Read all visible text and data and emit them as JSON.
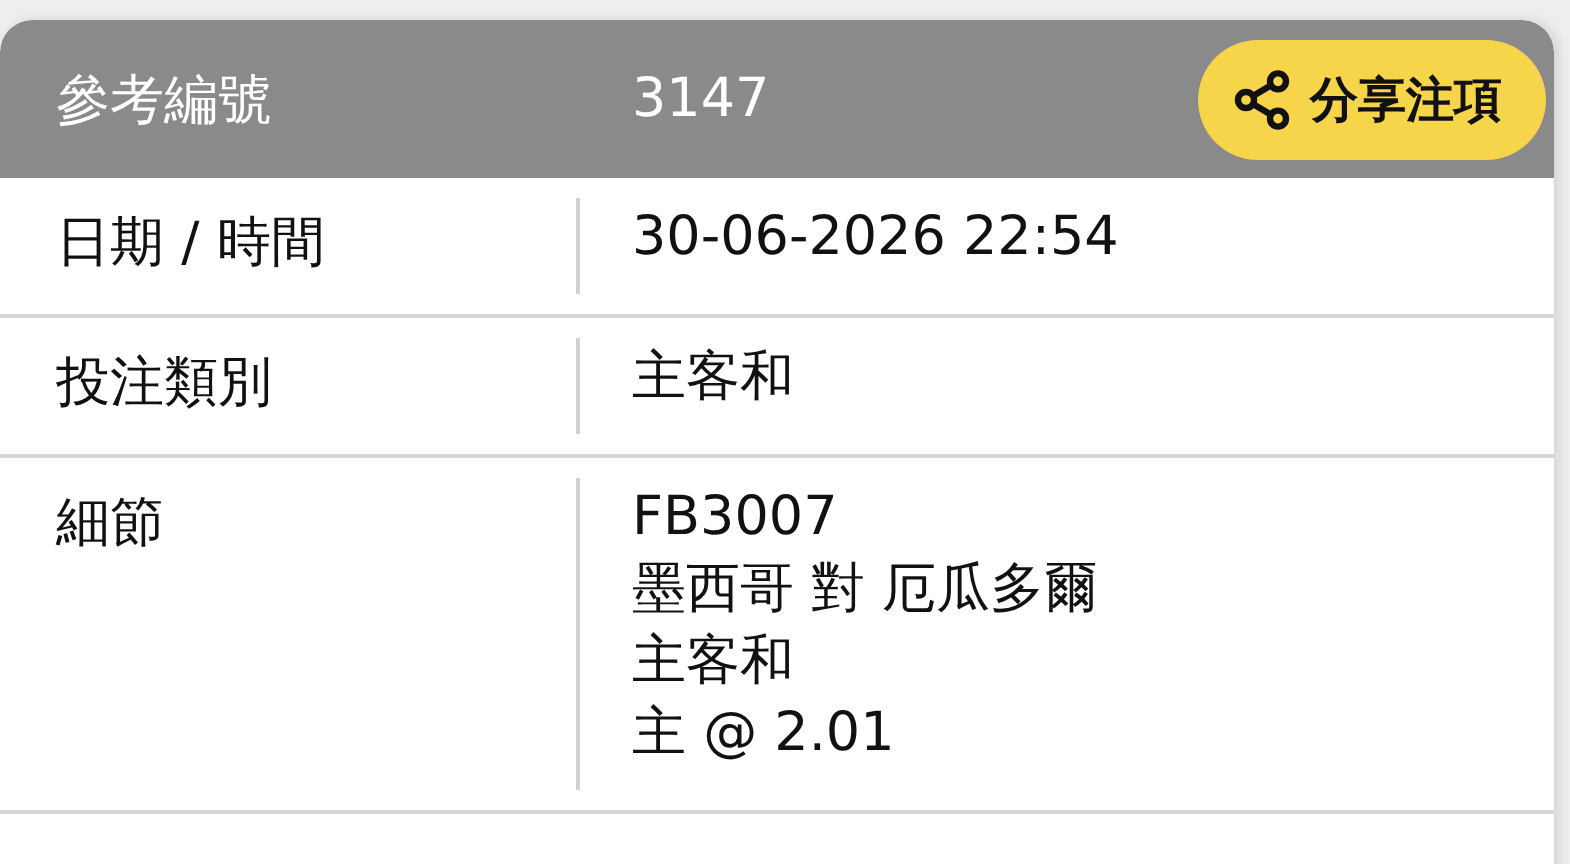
{
  "header": {
    "label": "參考編號",
    "value": "3147",
    "share_button": {
      "label": "分享注項"
    }
  },
  "rows": [
    {
      "label": "日期 / 時間",
      "lines": [
        "30-06-2026 22:54"
      ]
    },
    {
      "label": "投注類別",
      "lines": [
        "主客和"
      ]
    },
    {
      "label": "細節",
      "lines": [
        "FB3007",
        "墨西哥 對 厄瓜多爾",
        "主客和",
        "主 @ 2.01"
      ]
    }
  ]
}
